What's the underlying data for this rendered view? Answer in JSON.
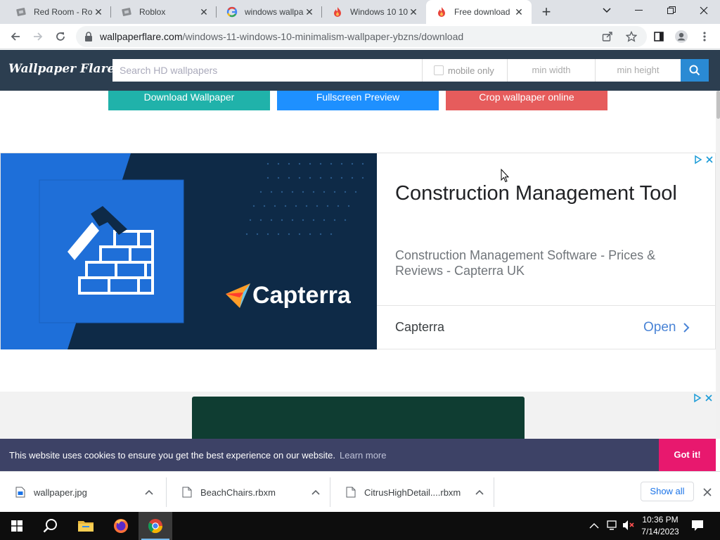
{
  "browser": {
    "tabs": [
      {
        "title": "Red Room - Roblox",
        "active": false
      },
      {
        "title": "Roblox",
        "active": false
      },
      {
        "title": "windows wallpaper",
        "active": false
      },
      {
        "title": "Windows 10 10K",
        "active": false
      },
      {
        "title": "Free download",
        "active": true
      }
    ],
    "new_tab_symbol": "+",
    "url_host": "wallpaperflare.com",
    "url_path": "/windows-11-windows-10-minimalism-wallpaper-ybzns/download"
  },
  "site": {
    "logo": "Wallpaper Flare",
    "search_placeholder": "Search HD wallpapers",
    "mobile_only_label": "mobile only",
    "min_width_placeholder": "min width",
    "min_height_placeholder": "min height"
  },
  "actions": {
    "download": "Download Wallpaper",
    "fullscreen": "Fullscreen Preview",
    "crop": "Crop wallpaper online",
    "colors": {
      "download": "#20b2aa",
      "fullscreen": "#1e90ff",
      "crop": "#e65c5c"
    }
  },
  "ad1": {
    "brand_logo_text": "Capterra",
    "headline": "Construction Management Tool",
    "description": "Construction Management Software - Prices & Reviews - Capterra UK",
    "advertiser": "Capterra",
    "cta": "Open"
  },
  "cookie": {
    "message": "This website uses cookies to ensure you get the best experience on our website.",
    "learn_more": "Learn more",
    "accept": "Got it!"
  },
  "downloads": {
    "items": [
      {
        "name": "wallpaper.jpg"
      },
      {
        "name": "BeachChairs.rbxm"
      },
      {
        "name": "CitrusHighDetail....rbxm"
      }
    ],
    "show_all": "Show all"
  },
  "taskbar": {
    "time": "10:36 PM",
    "date": "7/14/2023"
  }
}
